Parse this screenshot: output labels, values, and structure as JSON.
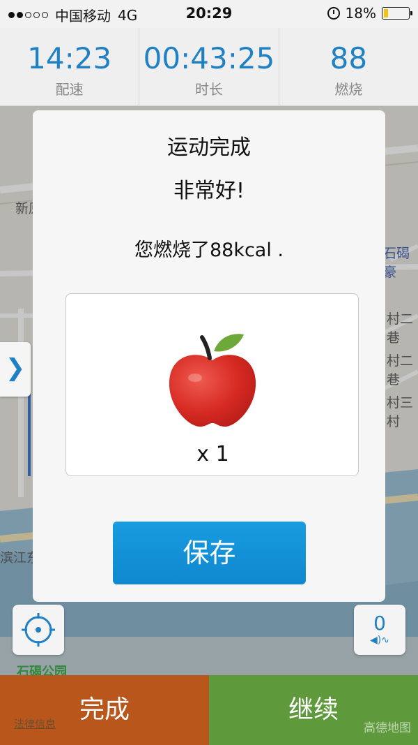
{
  "status_bar": {
    "carrier": "中国移动",
    "network": "4G",
    "time": "20:29",
    "battery": "18%",
    "battery_level": 0.18,
    "signal_strength": 2
  },
  "stats": [
    {
      "value": "14:23",
      "label": "配速"
    },
    {
      "value": "00:43:25",
      "label": "时长"
    },
    {
      "value": "88",
      "label": "燃烧"
    }
  ],
  "map": {
    "labels": [
      "新原",
      "石碣豪",
      "村二巷",
      "村二巷",
      "村三村",
      "滨江东",
      "石碣公园"
    ],
    "logo": "高德地图",
    "legal": "法律信息"
  },
  "dialog": {
    "title": "运动完成",
    "praise": "非常好!",
    "burn_text": "您燃烧了88kcal .",
    "reward_icon": "apple-icon",
    "reward_qty": "x 1",
    "save_label": "保存"
  },
  "controls": {
    "side_toggle": "❯",
    "voice_count": "0",
    "voice_symbol": "◀)∿"
  },
  "bottom": {
    "finish_label": "完成",
    "continue_label": "继续"
  },
  "colors": {
    "accent": "#1f80c4",
    "save": "#0f88d0",
    "finish": "#b8561c",
    "continue": "#5e9a3c"
  }
}
